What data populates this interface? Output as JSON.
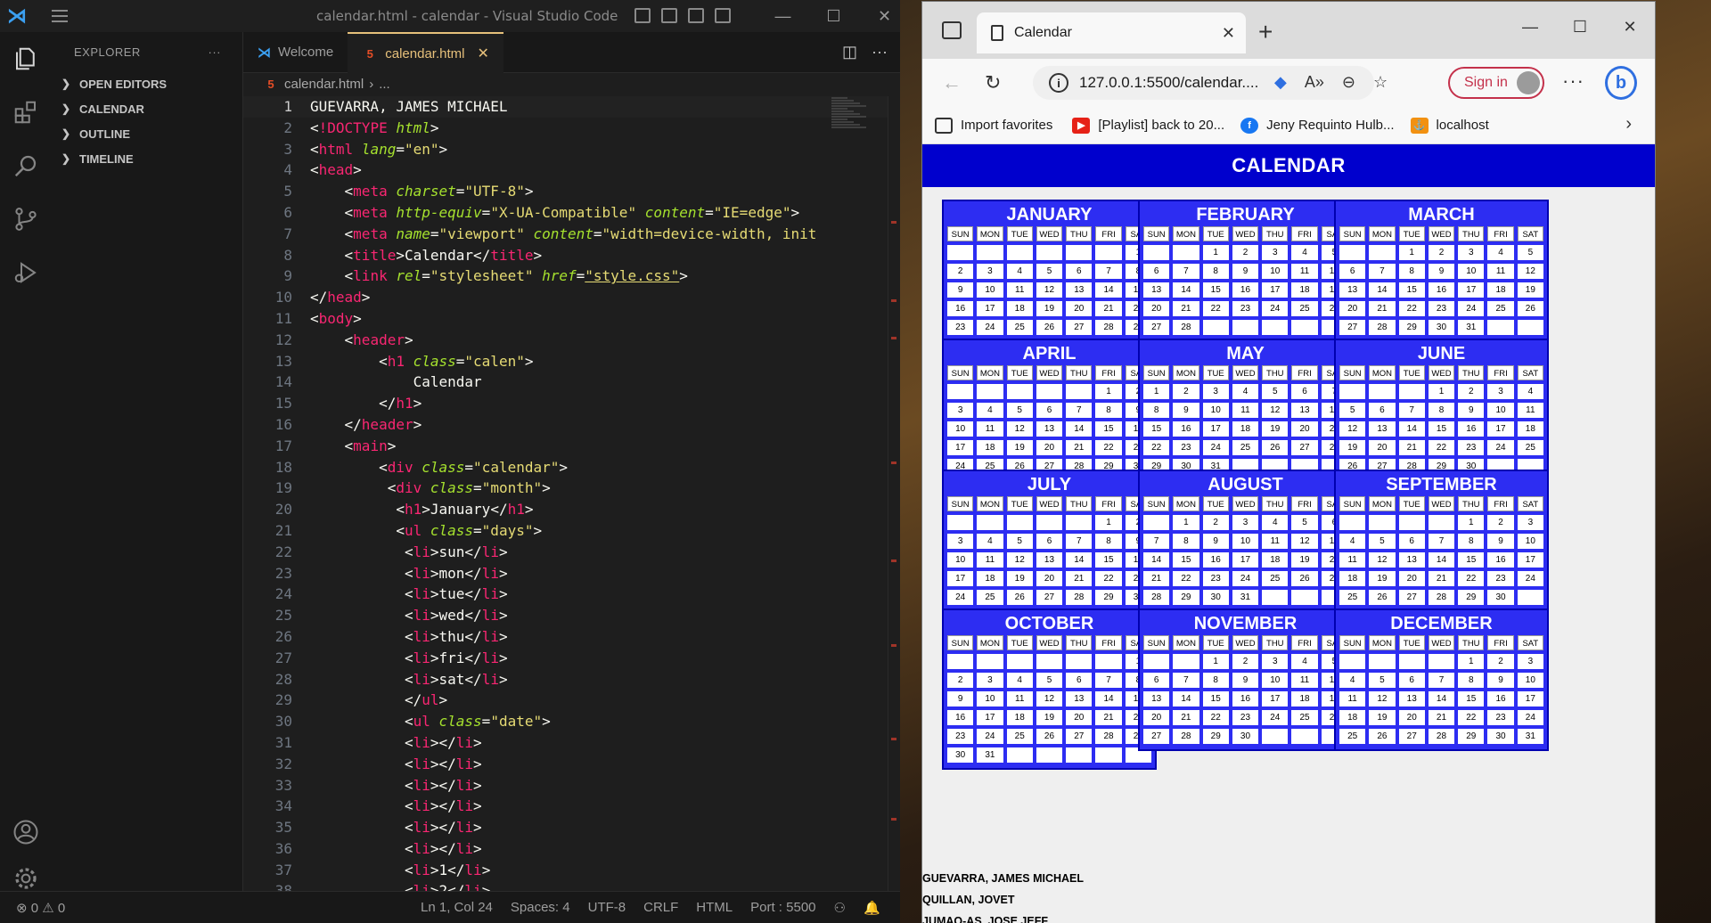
{
  "vscode": {
    "window_title": "calendar.html - calendar - Visual Studio Code",
    "explorer_label": "EXPLORER",
    "sections": [
      "OPEN EDITORS",
      "CALENDAR",
      "OUTLINE",
      "TIMELINE"
    ],
    "tabs": [
      {
        "label": "Welcome"
      },
      {
        "label": "calendar.html"
      }
    ],
    "breadcrumb": [
      "calendar.html",
      "..."
    ],
    "code_lines": [
      [
        {
          "c": "tx",
          "t": "GUEVARRA, JAMES MICHAEL"
        }
      ],
      [
        {
          "c": "pu",
          "t": "<"
        },
        {
          "c": "tg",
          "t": "!DOCTYPE"
        },
        {
          "c": "at",
          "t": " html"
        },
        {
          "c": "pu",
          "t": ">"
        }
      ],
      [
        {
          "c": "pu",
          "t": "<"
        },
        {
          "c": "tg",
          "t": "html"
        },
        {
          "c": "at",
          "t": " lang"
        },
        {
          "c": "pu",
          "t": "="
        },
        {
          "c": "st",
          "t": "\"en\""
        },
        {
          "c": "pu",
          "t": ">"
        }
      ],
      [
        {
          "c": "pu",
          "t": "<"
        },
        {
          "c": "tg",
          "t": "head"
        },
        {
          "c": "pu",
          "t": ">"
        }
      ],
      [
        {
          "c": "tx",
          "t": "    "
        },
        {
          "c": "pu",
          "t": "<"
        },
        {
          "c": "tg",
          "t": "meta"
        },
        {
          "c": "at",
          "t": " charset"
        },
        {
          "c": "pu",
          "t": "="
        },
        {
          "c": "st",
          "t": "\"UTF-8\""
        },
        {
          "c": "pu",
          "t": ">"
        }
      ],
      [
        {
          "c": "tx",
          "t": "    "
        },
        {
          "c": "pu",
          "t": "<"
        },
        {
          "c": "tg",
          "t": "meta"
        },
        {
          "c": "at",
          "t": " http-equiv"
        },
        {
          "c": "pu",
          "t": "="
        },
        {
          "c": "st",
          "t": "\"X-UA-Compatible\""
        },
        {
          "c": "at",
          "t": " content"
        },
        {
          "c": "pu",
          "t": "="
        },
        {
          "c": "st",
          "t": "\"IE=edge\""
        },
        {
          "c": "pu",
          "t": ">"
        }
      ],
      [
        {
          "c": "tx",
          "t": "    "
        },
        {
          "c": "pu",
          "t": "<"
        },
        {
          "c": "tg",
          "t": "meta"
        },
        {
          "c": "at",
          "t": " name"
        },
        {
          "c": "pu",
          "t": "="
        },
        {
          "c": "st",
          "t": "\"viewport\""
        },
        {
          "c": "at",
          "t": " content"
        },
        {
          "c": "pu",
          "t": "="
        },
        {
          "c": "st",
          "t": "\"width=device-width, init"
        }
      ],
      [
        {
          "c": "tx",
          "t": "    "
        },
        {
          "c": "pu",
          "t": "<"
        },
        {
          "c": "tg",
          "t": "title"
        },
        {
          "c": "pu",
          "t": ">"
        },
        {
          "c": "tx",
          "t": "Calendar"
        },
        {
          "c": "pu",
          "t": "</"
        },
        {
          "c": "tg",
          "t": "title"
        },
        {
          "c": "pu",
          "t": ">"
        }
      ],
      [
        {
          "c": "tx",
          "t": "    "
        },
        {
          "c": "pu",
          "t": "<"
        },
        {
          "c": "tg",
          "t": "link"
        },
        {
          "c": "at",
          "t": " rel"
        },
        {
          "c": "pu",
          "t": "="
        },
        {
          "c": "st",
          "t": "\"stylesheet\""
        },
        {
          "c": "at",
          "t": " href"
        },
        {
          "c": "pu",
          "t": "="
        },
        {
          "c": "st u",
          "t": "\"style.css\""
        },
        {
          "c": "pu",
          "t": ">"
        }
      ],
      [
        {
          "c": "pu",
          "t": "</"
        },
        {
          "c": "tg",
          "t": "head"
        },
        {
          "c": "pu",
          "t": ">"
        }
      ],
      [
        {
          "c": "pu",
          "t": "<"
        },
        {
          "c": "tg",
          "t": "body"
        },
        {
          "c": "pu",
          "t": ">"
        }
      ],
      [
        {
          "c": "tx",
          "t": "    "
        },
        {
          "c": "pu",
          "t": "<"
        },
        {
          "c": "tg",
          "t": "header"
        },
        {
          "c": "pu",
          "t": ">"
        }
      ],
      [
        {
          "c": "tx",
          "t": "        "
        },
        {
          "c": "pu",
          "t": "<"
        },
        {
          "c": "tg",
          "t": "h1"
        },
        {
          "c": "at",
          "t": " class"
        },
        {
          "c": "pu",
          "t": "="
        },
        {
          "c": "st",
          "t": "\"calen\""
        },
        {
          "c": "pu",
          "t": ">"
        }
      ],
      [
        {
          "c": "tx",
          "t": "            Calendar"
        }
      ],
      [
        {
          "c": "tx",
          "t": "        "
        },
        {
          "c": "pu",
          "t": "</"
        },
        {
          "c": "tg",
          "t": "h1"
        },
        {
          "c": "pu",
          "t": ">"
        }
      ],
      [
        {
          "c": "tx",
          "t": "    "
        },
        {
          "c": "pu",
          "t": "</"
        },
        {
          "c": "tg",
          "t": "header"
        },
        {
          "c": "pu",
          "t": ">"
        }
      ],
      [
        {
          "c": "tx",
          "t": "    "
        },
        {
          "c": "pu",
          "t": "<"
        },
        {
          "c": "tg",
          "t": "main"
        },
        {
          "c": "pu",
          "t": ">"
        }
      ],
      [
        {
          "c": "tx",
          "t": "        "
        },
        {
          "c": "pu",
          "t": "<"
        },
        {
          "c": "tg",
          "t": "div"
        },
        {
          "c": "at",
          "t": " class"
        },
        {
          "c": "pu",
          "t": "="
        },
        {
          "c": "st",
          "t": "\"calendar\""
        },
        {
          "c": "pu",
          "t": ">"
        }
      ],
      [
        {
          "c": "tx",
          "t": "         "
        },
        {
          "c": "pu",
          "t": "<"
        },
        {
          "c": "tg",
          "t": "div"
        },
        {
          "c": "at",
          "t": " class"
        },
        {
          "c": "pu",
          "t": "="
        },
        {
          "c": "st",
          "t": "\"month\""
        },
        {
          "c": "pu",
          "t": ">"
        }
      ],
      [
        {
          "c": "tx",
          "t": "          "
        },
        {
          "c": "pu",
          "t": "<"
        },
        {
          "c": "tg",
          "t": "h1"
        },
        {
          "c": "pu",
          "t": ">"
        },
        {
          "c": "tx",
          "t": "January"
        },
        {
          "c": "pu",
          "t": "</"
        },
        {
          "c": "tg",
          "t": "h1"
        },
        {
          "c": "pu",
          "t": ">"
        }
      ],
      [
        {
          "c": "tx",
          "t": "          "
        },
        {
          "c": "pu",
          "t": "<"
        },
        {
          "c": "tg",
          "t": "ul"
        },
        {
          "c": "at",
          "t": " class"
        },
        {
          "c": "pu",
          "t": "="
        },
        {
          "c": "st",
          "t": "\"days\""
        },
        {
          "c": "pu",
          "t": ">"
        }
      ],
      [
        {
          "c": "tx",
          "t": "           "
        },
        {
          "c": "pu",
          "t": "<"
        },
        {
          "c": "tg",
          "t": "li"
        },
        {
          "c": "pu",
          "t": ">"
        },
        {
          "c": "tx",
          "t": "sun"
        },
        {
          "c": "pu",
          "t": "</"
        },
        {
          "c": "tg",
          "t": "li"
        },
        {
          "c": "pu",
          "t": ">"
        }
      ],
      [
        {
          "c": "tx",
          "t": "           "
        },
        {
          "c": "pu",
          "t": "<"
        },
        {
          "c": "tg",
          "t": "li"
        },
        {
          "c": "pu",
          "t": ">"
        },
        {
          "c": "tx",
          "t": "mon"
        },
        {
          "c": "pu",
          "t": "</"
        },
        {
          "c": "tg",
          "t": "li"
        },
        {
          "c": "pu",
          "t": ">"
        }
      ],
      [
        {
          "c": "tx",
          "t": "           "
        },
        {
          "c": "pu",
          "t": "<"
        },
        {
          "c": "tg",
          "t": "li"
        },
        {
          "c": "pu",
          "t": ">"
        },
        {
          "c": "tx",
          "t": "tue"
        },
        {
          "c": "pu",
          "t": "</"
        },
        {
          "c": "tg",
          "t": "li"
        },
        {
          "c": "pu",
          "t": ">"
        }
      ],
      [
        {
          "c": "tx",
          "t": "           "
        },
        {
          "c": "pu",
          "t": "<"
        },
        {
          "c": "tg",
          "t": "li"
        },
        {
          "c": "pu",
          "t": ">"
        },
        {
          "c": "tx",
          "t": "wed"
        },
        {
          "c": "pu",
          "t": "</"
        },
        {
          "c": "tg",
          "t": "li"
        },
        {
          "c": "pu",
          "t": ">"
        }
      ],
      [
        {
          "c": "tx",
          "t": "           "
        },
        {
          "c": "pu",
          "t": "<"
        },
        {
          "c": "tg",
          "t": "li"
        },
        {
          "c": "pu",
          "t": ">"
        },
        {
          "c": "tx",
          "t": "thu"
        },
        {
          "c": "pu",
          "t": "</"
        },
        {
          "c": "tg",
          "t": "li"
        },
        {
          "c": "pu",
          "t": ">"
        }
      ],
      [
        {
          "c": "tx",
          "t": "           "
        },
        {
          "c": "pu",
          "t": "<"
        },
        {
          "c": "tg",
          "t": "li"
        },
        {
          "c": "pu",
          "t": ">"
        },
        {
          "c": "tx",
          "t": "fri"
        },
        {
          "c": "pu",
          "t": "</"
        },
        {
          "c": "tg",
          "t": "li"
        },
        {
          "c": "pu",
          "t": ">"
        }
      ],
      [
        {
          "c": "tx",
          "t": "           "
        },
        {
          "c": "pu",
          "t": "<"
        },
        {
          "c": "tg",
          "t": "li"
        },
        {
          "c": "pu",
          "t": ">"
        },
        {
          "c": "tx",
          "t": "sat"
        },
        {
          "c": "pu",
          "t": "</"
        },
        {
          "c": "tg",
          "t": "li"
        },
        {
          "c": "pu",
          "t": ">"
        }
      ],
      [
        {
          "c": "tx",
          "t": "           "
        },
        {
          "c": "pu",
          "t": "</"
        },
        {
          "c": "tg",
          "t": "ul"
        },
        {
          "c": "pu",
          "t": ">"
        }
      ],
      [
        {
          "c": "tx",
          "t": "           "
        },
        {
          "c": "pu",
          "t": "<"
        },
        {
          "c": "tg",
          "t": "ul"
        },
        {
          "c": "at",
          "t": " class"
        },
        {
          "c": "pu",
          "t": "="
        },
        {
          "c": "st",
          "t": "\"date\""
        },
        {
          "c": "pu",
          "t": ">"
        }
      ],
      [
        {
          "c": "tx",
          "t": "           "
        },
        {
          "c": "pu",
          "t": "<"
        },
        {
          "c": "tg",
          "t": "li"
        },
        {
          "c": "pu",
          "t": "></"
        },
        {
          "c": "tg",
          "t": "li"
        },
        {
          "c": "pu",
          "t": ">"
        }
      ],
      [
        {
          "c": "tx",
          "t": "           "
        },
        {
          "c": "pu",
          "t": "<"
        },
        {
          "c": "tg",
          "t": "li"
        },
        {
          "c": "pu",
          "t": "></"
        },
        {
          "c": "tg",
          "t": "li"
        },
        {
          "c": "pu",
          "t": ">"
        }
      ],
      [
        {
          "c": "tx",
          "t": "           "
        },
        {
          "c": "pu",
          "t": "<"
        },
        {
          "c": "tg",
          "t": "li"
        },
        {
          "c": "pu",
          "t": "></"
        },
        {
          "c": "tg",
          "t": "li"
        },
        {
          "c": "pu",
          "t": ">"
        }
      ],
      [
        {
          "c": "tx",
          "t": "           "
        },
        {
          "c": "pu",
          "t": "<"
        },
        {
          "c": "tg",
          "t": "li"
        },
        {
          "c": "pu",
          "t": "></"
        },
        {
          "c": "tg",
          "t": "li"
        },
        {
          "c": "pu",
          "t": ">"
        }
      ],
      [
        {
          "c": "tx",
          "t": "           "
        },
        {
          "c": "pu",
          "t": "<"
        },
        {
          "c": "tg",
          "t": "li"
        },
        {
          "c": "pu",
          "t": "></"
        },
        {
          "c": "tg",
          "t": "li"
        },
        {
          "c": "pu",
          "t": ">"
        }
      ],
      [
        {
          "c": "tx",
          "t": "           "
        },
        {
          "c": "pu",
          "t": "<"
        },
        {
          "c": "tg",
          "t": "li"
        },
        {
          "c": "pu",
          "t": "></"
        },
        {
          "c": "tg",
          "t": "li"
        },
        {
          "c": "pu",
          "t": ">"
        }
      ],
      [
        {
          "c": "tx",
          "t": "           "
        },
        {
          "c": "pu",
          "t": "<"
        },
        {
          "c": "tg",
          "t": "li"
        },
        {
          "c": "pu",
          "t": ">"
        },
        {
          "c": "tx",
          "t": "1"
        },
        {
          "c": "pu",
          "t": "</"
        },
        {
          "c": "tg",
          "t": "li"
        },
        {
          "c": "pu",
          "t": ">"
        }
      ],
      [
        {
          "c": "tx",
          "t": "           "
        },
        {
          "c": "pu",
          "t": "<"
        },
        {
          "c": "tg",
          "t": "li"
        },
        {
          "c": "pu",
          "t": ">"
        },
        {
          "c": "tx",
          "t": "2"
        },
        {
          "c": "pu",
          "t": "</"
        },
        {
          "c": "tg",
          "t": "li"
        },
        {
          "c": "pu",
          "t": ">"
        }
      ]
    ],
    "status": {
      "problems": "⊗ 0 ⚠ 0",
      "position": "Ln 1, Col 24",
      "spaces": "Spaces: 4",
      "encoding": "UTF-8",
      "eol": "CRLF",
      "language": "HTML",
      "port": "Port : 5500"
    }
  },
  "browser": {
    "tab_title": "Calendar",
    "url": "127.0.0.1:5500/calendar....",
    "sign_in": "Sign in",
    "favorites": [
      "Import favorites",
      "[Playlist] back to 20...",
      "Jeny Requinto Hulb...",
      "localhost"
    ],
    "page": {
      "header": "CALENDAR",
      "weekdays": [
        "SUN",
        "MON",
        "TUE",
        "WED",
        "THU",
        "FRI",
        "SAT"
      ],
      "months": [
        {
          "name": "JANUARY",
          "start": 6,
          "days": 31
        },
        {
          "name": "FEBRUARY",
          "start": 2,
          "days": 28
        },
        {
          "name": "MARCH",
          "start": 2,
          "days": 31
        },
        {
          "name": "APRIL",
          "start": 5,
          "days": 30
        },
        {
          "name": "MAY",
          "start": 0,
          "days": 31
        },
        {
          "name": "JUNE",
          "start": 3,
          "days": 30
        },
        {
          "name": "JULY",
          "start": 5,
          "days": 31
        },
        {
          "name": "AUGUST",
          "start": 1,
          "days": 31
        },
        {
          "name": "SEPTEMBER",
          "start": 4,
          "days": 30
        },
        {
          "name": "OCTOBER",
          "start": 6,
          "days": 31
        },
        {
          "name": "NOVEMBER",
          "start": 2,
          "days": 30
        },
        {
          "name": "DECEMBER",
          "start": 4,
          "days": 31
        }
      ],
      "authors": [
        "GUEVARRA, JAMES MICHAEL",
        "QUILLAN, JOVET",
        "JUMAO-AS, JOSE JEFF"
      ]
    }
  },
  "colors": {
    "calendar_blue": "#2d2df2",
    "header_blue": "#0000cd",
    "vscode_bg": "#1e1e1e",
    "accent_tab": "#e6c07b"
  }
}
